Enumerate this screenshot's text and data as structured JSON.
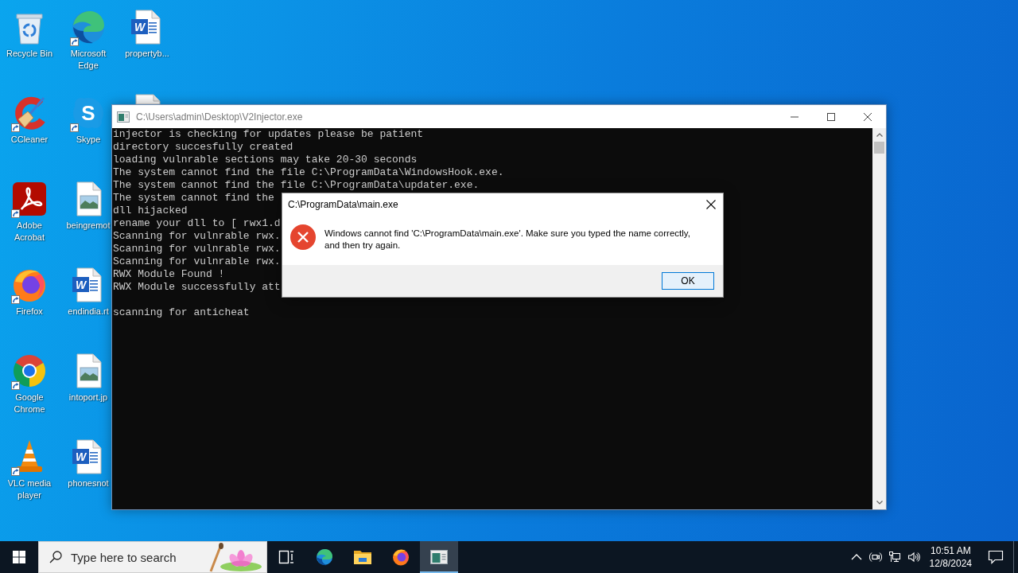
{
  "desktop": {
    "icons": [
      {
        "label": "Recycle Bin",
        "kind": "recycle-bin",
        "shortcut": false
      },
      {
        "label": "CCleaner",
        "kind": "ccleaner",
        "shortcut": true
      },
      {
        "label": "Adobe Acrobat",
        "kind": "acrobat",
        "shortcut": true
      },
      {
        "label": "Firefox",
        "kind": "firefox",
        "shortcut": true
      },
      {
        "label": "Google Chrome",
        "kind": "chrome",
        "shortcut": true
      },
      {
        "label": "VLC media player",
        "kind": "vlc",
        "shortcut": true
      },
      {
        "label": "Microsoft Edge",
        "kind": "edge",
        "shortcut": true
      },
      {
        "label": "Skype",
        "kind": "skype",
        "glyph": "S",
        "shortcut": true
      },
      {
        "label": "beingremot",
        "kind": "image-file",
        "shortcut": false
      },
      {
        "label": "endindia.rt",
        "kind": "word-file",
        "glyph": "W",
        "shortcut": false
      },
      {
        "label": "intoport.jp",
        "kind": "image-file",
        "shortcut": false
      },
      {
        "label": "phonesnot",
        "kind": "word-file",
        "glyph": "W",
        "shortcut": false
      },
      {
        "label": "propertyb...",
        "kind": "word-file",
        "glyph": "W",
        "shortcut": false
      },
      {
        "kind": "file-edge",
        "shortcut": false
      }
    ]
  },
  "console_window": {
    "title": "C:\\Users\\admin\\Desktop\\V2Injector.exe",
    "active": false,
    "lines": [
      "injector is checking for updates please be patient",
      "directory succesfully created",
      "loading vulnrable sections may take 20-30 seconds",
      "The system cannot find the file C:\\ProgramData\\WindowsHook.exe.",
      "The system cannot find the file C:\\ProgramData\\updater.exe.",
      "The system cannot find the",
      "dll hijacked",
      "rename your dll to [ rwx1.d",
      "Scanning for vulnrable rwx.",
      "Scanning for vulnrable rwx.",
      "Scanning for vulnrable rwx.",
      "RWX Module Found !",
      "RWX Module successfully att"
    ],
    "lines_after_blank": [
      "scanning for anticheat"
    ]
  },
  "dialog": {
    "title": "C:\\ProgramData\\main.exe",
    "active": true,
    "message": "Windows cannot find 'C:\\ProgramData\\main.exe'. Make sure you typed the name correctly, and then try again.",
    "buttons": [
      {
        "label": "OK",
        "default": true
      }
    ]
  },
  "taskbar": {
    "search": {
      "placeholder": "Type here to search"
    },
    "apps": [
      {
        "kind": "task-view",
        "selected": false
      },
      {
        "kind": "edge",
        "selected": false
      },
      {
        "kind": "file-explorer",
        "selected": false
      },
      {
        "kind": "firefox",
        "selected": false
      },
      {
        "kind": "console",
        "selected": true
      }
    ],
    "clock": {
      "time": "10:51 AM",
      "date": "12/8/2024"
    }
  }
}
